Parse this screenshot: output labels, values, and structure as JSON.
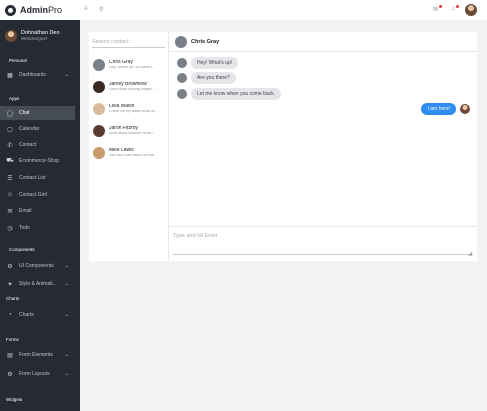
{
  "brand": {
    "name_bold": "Admin",
    "name_light": "Pro"
  },
  "user": {
    "name": "Dohnathan Deo",
    "role": "Webdesigner"
  },
  "sidebar": {
    "sections": {
      "personal": "Personal",
      "apps": "Apps",
      "components": "Components",
      "charts": "Charts",
      "forms": "Forms",
      "widgets": "Widgets"
    },
    "items": [
      {
        "label": "Dashboards",
        "icon": "grid-icon",
        "chevron": true
      },
      {
        "label": "Chat",
        "icon": "chat-icon",
        "active": true
      },
      {
        "label": "Calendar",
        "icon": "calendar-icon"
      },
      {
        "label": "Contact",
        "icon": "phone-icon"
      },
      {
        "label": "Ecommerce-Shop",
        "icon": "cart-icon"
      },
      {
        "label": "Contact List",
        "icon": "contact-list-icon"
      },
      {
        "label": "Contact Grid",
        "icon": "contact-grid-icon"
      },
      {
        "label": "Email",
        "icon": "mail-icon"
      },
      {
        "label": "Todo",
        "icon": "todo-icon"
      },
      {
        "label": "UI Components",
        "icon": "components-icon",
        "chevron": true
      },
      {
        "label": "Style & Animati...",
        "icon": "style-icon",
        "chevron": true
      },
      {
        "label": "Charts",
        "icon": "chart-icon",
        "chevron": true
      },
      {
        "label": "Form Elements",
        "icon": "form-elements-icon",
        "chevron": true
      },
      {
        "label": "Form Layouts",
        "icon": "form-layouts-icon",
        "chevron": true
      }
    ]
  },
  "topbar": {
    "menu_icon": "menu-icon",
    "search_icon": "search-icon"
  },
  "chat": {
    "search_placeholder": "Search contact",
    "contacts": [
      {
        "name": "Chris Gray",
        "msg": "Hey! What's up! So many ti...",
        "color": "#7a8088"
      },
      {
        "name": "Jamey Brownlow",
        "msg": "Good news coming tonight, ...",
        "color": "#3b2a22"
      },
      {
        "name": "Livia Walsh",
        "msg": "Check out my latest email on ...",
        "color": "#d9b99a"
      },
      {
        "name": "Jaron Fitzroy",
        "msg": "What about summer break?",
        "color": "#5a3d2e"
      },
      {
        "name": "Mike Lewis",
        "msg": "Just don't care about the we...",
        "color": "#c99a6b"
      }
    ],
    "active_contact": "Chris Gray",
    "messages": [
      {
        "text": "Hey! What's up!",
        "dir": "in"
      },
      {
        "text": "Are you there?",
        "dir": "in"
      },
      {
        "text": "Let me know when you come back.",
        "dir": "in"
      },
      {
        "text": "I am here!",
        "dir": "out"
      }
    ],
    "composer_placeholder": "Type and hit Enter"
  }
}
